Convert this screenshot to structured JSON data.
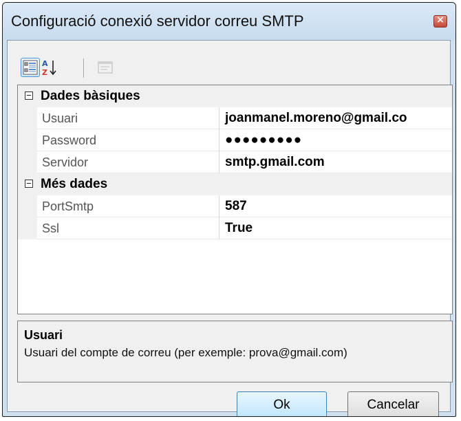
{
  "window": {
    "title": "Configuració conexió servidor correu SMTP",
    "close_glyph": "×"
  },
  "toolbar": {
    "buttons": [
      {
        "icon": "categorized-icon",
        "pressed": true
      },
      {
        "icon": "alphabetical-sort-icon",
        "pressed": false
      },
      {
        "icon": "property-pages-icon",
        "enabled": false
      }
    ]
  },
  "property_grid": {
    "categories": [
      {
        "label": "Dades bàsiques",
        "expanded": true,
        "properties": [
          {
            "name": "Usuari",
            "value": "joanmanel.moreno@gmail.co"
          },
          {
            "name": "Password",
            "value": "●●●●●●●●●"
          },
          {
            "name": "Servidor",
            "value": "smtp.gmail.com"
          }
        ]
      },
      {
        "label": "Més dades",
        "expanded": true,
        "properties": [
          {
            "name": "PortSmtp",
            "value": "587"
          },
          {
            "name": "Ssl",
            "value": "True"
          }
        ]
      }
    ]
  },
  "help": {
    "title": "Usuari",
    "description": "Usuari del compte de correu (per exemple: prova@gmail.com)"
  },
  "buttons": {
    "ok_label": "Ok",
    "cancel_label": "Cancelar"
  },
  "colors": {
    "window_frame": "#cfe0f1",
    "client_background": "#f0f0f0",
    "default_button_border": "#3c7fb1",
    "close_button": "#c4493a"
  }
}
